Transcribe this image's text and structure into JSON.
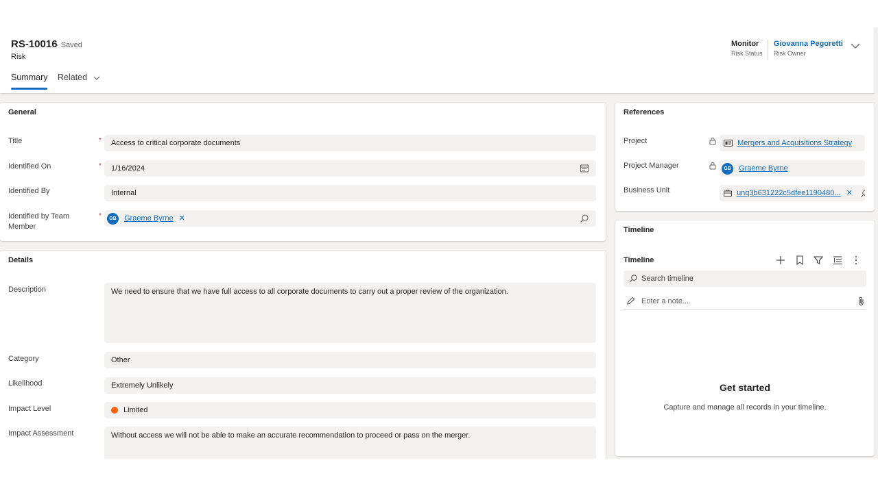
{
  "record": {
    "id": "RS-10016",
    "save_status": "- Saved",
    "entity": "Risk"
  },
  "tabs": {
    "summary": "Summary",
    "related": "Related"
  },
  "header_fields": {
    "risk_status": {
      "value": "Monitor",
      "label": "Risk Status"
    },
    "risk_owner": {
      "value": "Giovanna Pegoretti",
      "label": "Risk Owner"
    }
  },
  "general": {
    "title": "General",
    "fields": {
      "title": {
        "label": "Title",
        "value": "Access to critical corporate documents"
      },
      "identified_on": {
        "label": "Identified On",
        "value": "1/16/2024"
      },
      "identified_by": {
        "label": "Identified By",
        "value": "Internal"
      },
      "identified_by_member": {
        "label": "Identified by Team Member",
        "value": "Graeme Byrne",
        "initials": "GB"
      }
    }
  },
  "details": {
    "title": "Details",
    "fields": {
      "description": {
        "label": "Description",
        "value": "We need to ensure that we have full access to all corporate documents to carry out a proper review of the organization."
      },
      "category": {
        "label": "Category",
        "value": "Other"
      },
      "likelihood": {
        "label": "Likelihood",
        "value": "Extremely Unlikely"
      },
      "impact_level": {
        "label": "Impact Level",
        "value": "Limited",
        "color": "#f7630c"
      },
      "impact_assessment": {
        "label": "Impact Assessment",
        "value": "Without access we will not be able to make an accurate recommendation to proceed or pass on the merger."
      }
    }
  },
  "references": {
    "title": "References",
    "project": {
      "label": "Project",
      "value": "Mergers and Acquisitions Strategy"
    },
    "project_manager": {
      "label": "Project Manager",
      "value": "Graeme Byrne",
      "initials": "GB"
    },
    "business_unit": {
      "label": "Business Unit",
      "value": "unq3b631222c5dfee1190480..."
    }
  },
  "timeline": {
    "section_title": "Timeline",
    "header": "Timeline",
    "search_placeholder": "Search timeline",
    "note_placeholder": "Enter a note...",
    "empty_title": "Get started",
    "empty_subtitle": "Capture and manage all records in your timeline."
  },
  "colors": {
    "accent": "#0f6cbd",
    "required": "#c4314b",
    "field_bg": "#f3f2f1"
  }
}
